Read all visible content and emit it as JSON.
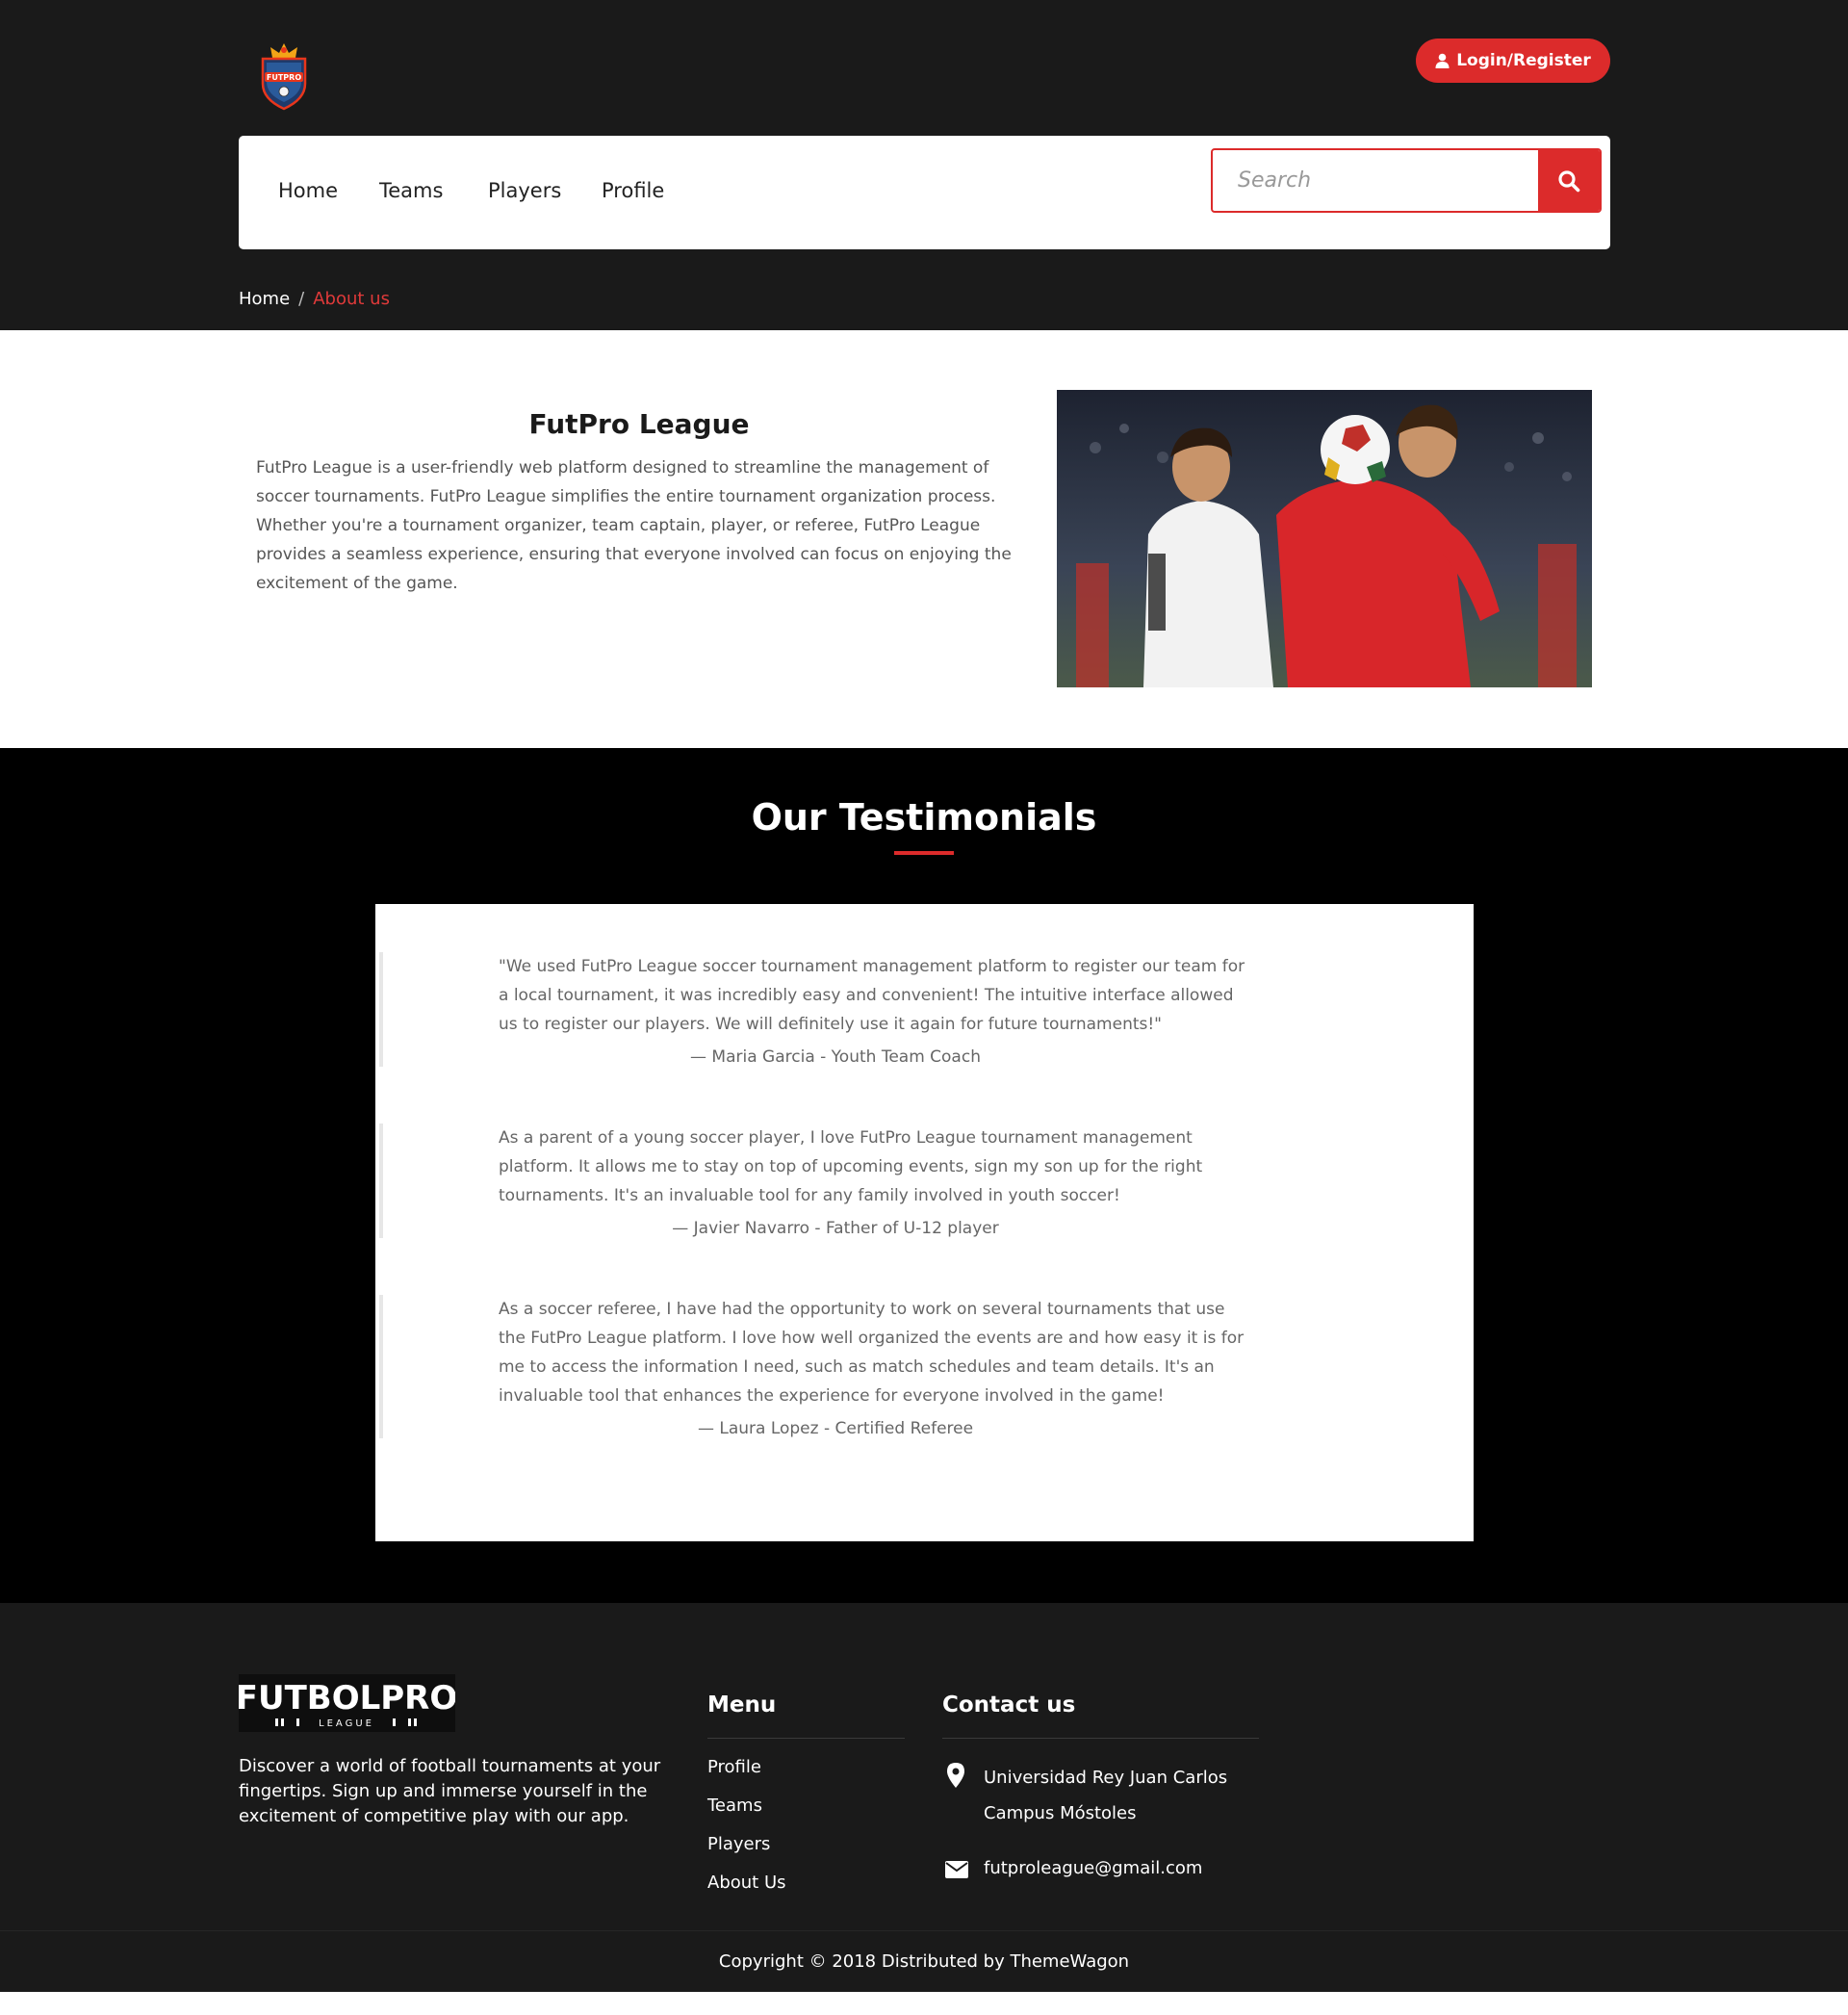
{
  "header": {
    "login_label": "Login/Register",
    "logo_alt": "FUTPRO",
    "nav": [
      "Home",
      "Teams",
      "Players",
      "Profile"
    ],
    "search_placeholder": "Search"
  },
  "breadcrumb": {
    "home": "Home",
    "separator": "/",
    "current": "About us"
  },
  "about": {
    "title": "FutPro League",
    "text": "FutPro League is a user-friendly web platform designed to streamline the management of soccer tournaments. FutPro League simplifies the entire tournament organization process. Whether you're a tournament organizer, team captain, player, or referee, FutPro League provides a seamless experience, ensuring that everyone involved can focus on enjoying the excitement of the game."
  },
  "testimonials": {
    "heading": "Our Testimonials",
    "items": [
      {
        "text": "\"We used FutPro League soccer tournament management platform to register our team for a local tournament, it was incredibly easy and convenient! The intuitive interface allowed us to register our players. We will definitely use it again for future tournaments!\"",
        "author": "— Maria Garcia - Youth Team Coach"
      },
      {
        "text": "As a parent of a young soccer player, I love FutPro League tournament management platform. It allows me to stay on top of upcoming events, sign my son up for the right tournaments. It's an invaluable tool for any family involved in youth soccer!",
        "author": "— Javier Navarro - Father of U-12 player"
      },
      {
        "text": "As a soccer referee, I have had the opportunity to work on several tournaments that use the FutPro League platform. I love how well organized the events are and how easy it is for me to access the information I need, such as match schedules and team details. It's an invaluable tool that enhances the experience for everyone involved in the game!",
        "author": "— Laura Lopez - Certified Referee"
      }
    ]
  },
  "footer": {
    "logo_text": "FUTBOLPRO",
    "logo_subtext": "LEAGUE",
    "description": "Discover a world of football tournaments at your fingertips. Sign up and immerse yourself in the excitement of competitive play with our app.",
    "menu_title": "Menu",
    "menu": [
      "Profile",
      "Teams",
      "Players",
      "About Us"
    ],
    "contact_title": "Contact us",
    "address_line1": "Universidad Rey Juan Carlos",
    "address_line2": "Campus Móstoles",
    "email": "futproleague@gmail.com",
    "copyright": "Copyright © 2018 Distributed by ThemeWagon"
  },
  "colors": {
    "accent": "#dc2b2b",
    "header_bg": "#1a1a1a",
    "testimonials_bg": "#000000"
  },
  "icons": [
    "user-icon",
    "search-icon",
    "map-pin-icon",
    "envelope-icon"
  ]
}
